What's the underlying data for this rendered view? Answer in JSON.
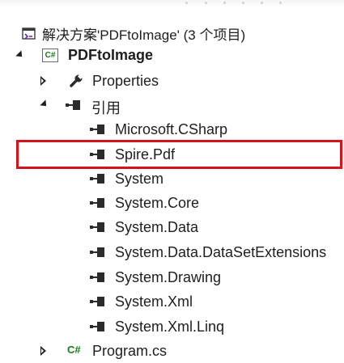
{
  "solution": {
    "label": "解决方案'PDFtoImage' (3 个项目)"
  },
  "project": {
    "label": "PDFtoImage"
  },
  "properties": {
    "label": "Properties"
  },
  "references": {
    "label": "引用",
    "items": [
      "Microsoft.CSharp",
      "Spire.Pdf",
      "System",
      "System.Core",
      "System.Data",
      "System.Data.DataSetExtensions",
      "System.Drawing",
      "System.Xml",
      "System.Xml.Linq"
    ]
  },
  "program_file": {
    "label": "Program.cs"
  },
  "colors": {
    "highlight": "#d2151c",
    "csharp_green": "#1c7b1c",
    "text": "#1e1e1e"
  },
  "icons": [
    "solution-icon",
    "csharp-project-icon",
    "wrench-icon",
    "reference-icon",
    "csharp-file-icon"
  ]
}
